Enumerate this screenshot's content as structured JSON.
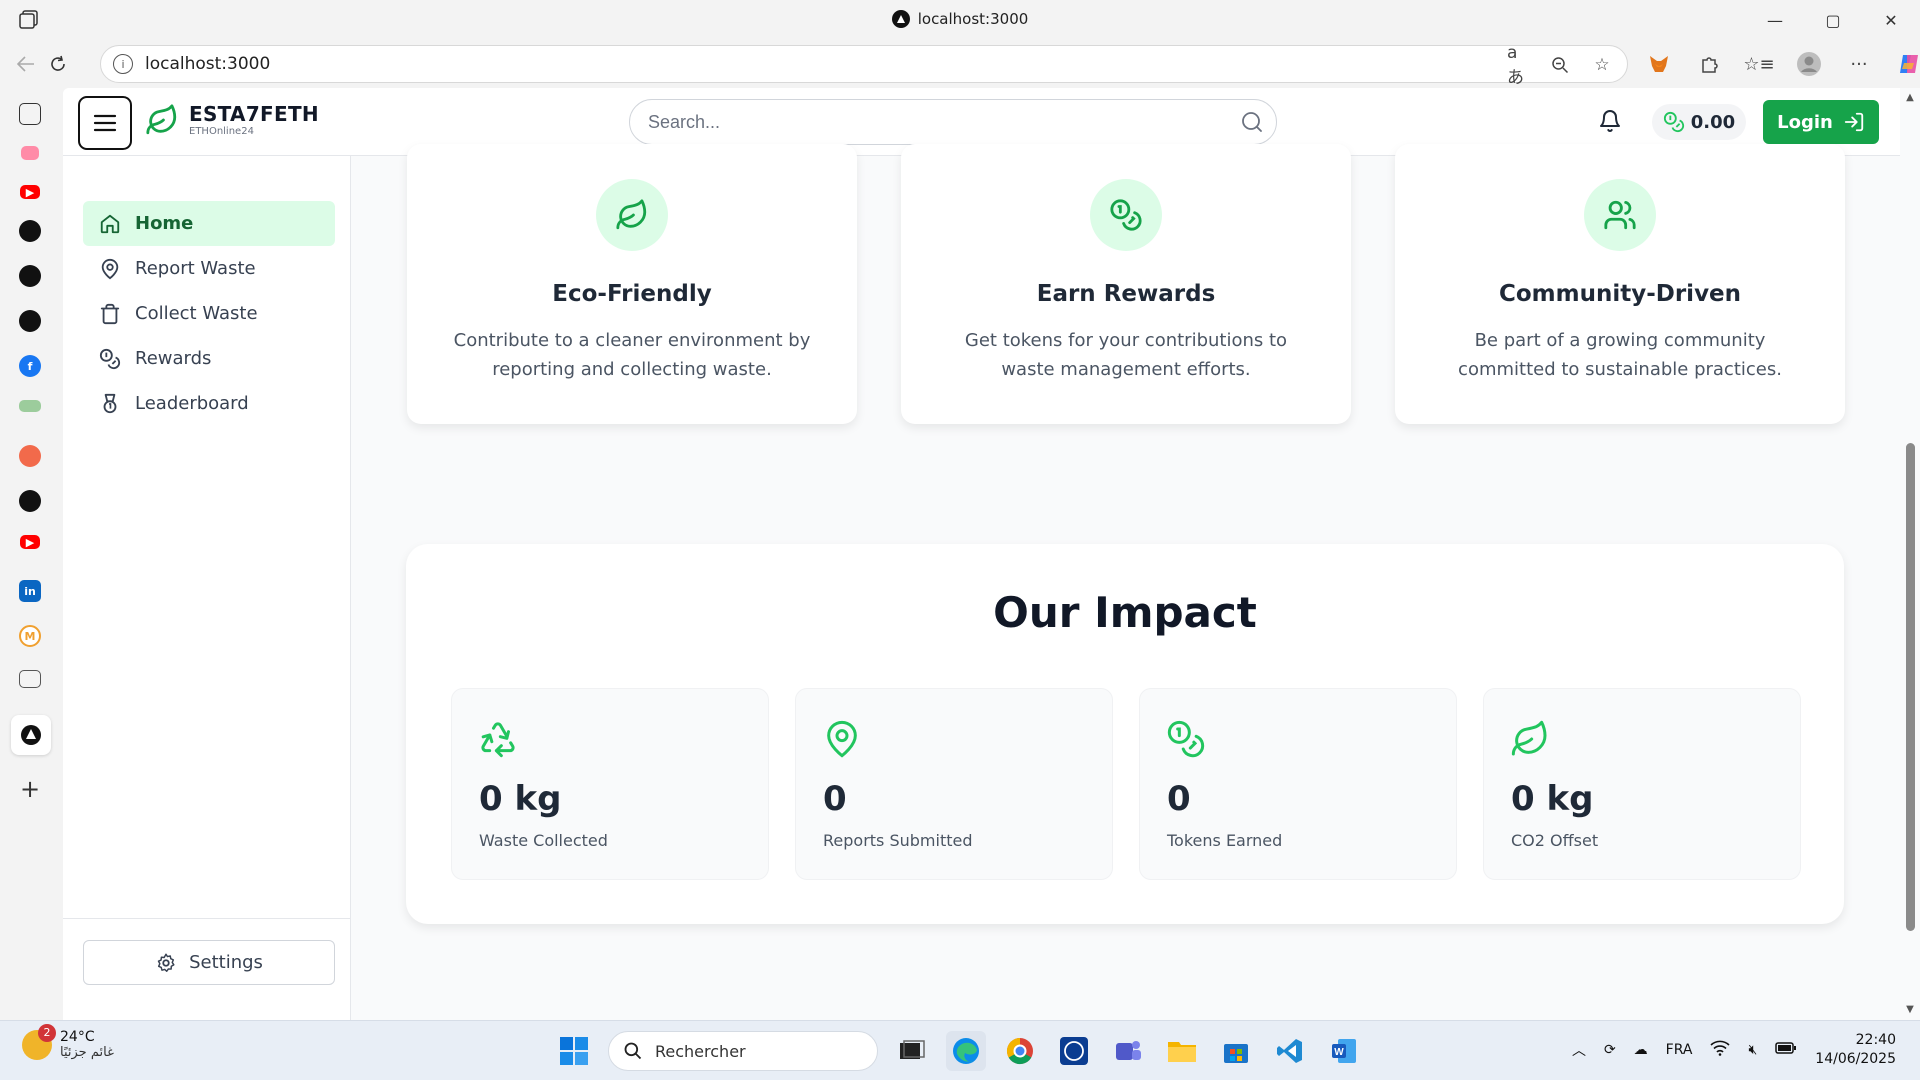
{
  "browser": {
    "tab_title": "localhost:3000",
    "url": "localhost:3000",
    "minimize": "—",
    "maximize": "▢",
    "close": "✕"
  },
  "header": {
    "brand": "ESTA7FETH",
    "tagline": "ETHOnline24",
    "search_placeholder": "Search...",
    "balance": "0.00",
    "login_label": "Login"
  },
  "sidebar": {
    "items": [
      {
        "label": "Home",
        "icon": "home-icon",
        "active": true
      },
      {
        "label": "Report Waste",
        "icon": "map-pin-icon",
        "active": false
      },
      {
        "label": "Collect Waste",
        "icon": "trash-icon",
        "active": false
      },
      {
        "label": "Rewards",
        "icon": "coins-icon",
        "active": false
      },
      {
        "label": "Leaderboard",
        "icon": "medal-icon",
        "active": false
      }
    ],
    "settings_label": "Settings"
  },
  "features": [
    {
      "title": "Eco-Friendly",
      "description": "Contribute to a cleaner environment by reporting and collecting waste.",
      "icon": "leaf-icon"
    },
    {
      "title": "Earn Rewards",
      "description": "Get tokens for your contributions to waste management efforts.",
      "icon": "coins-icon"
    },
    {
      "title": "Community-Driven",
      "description": "Be part of a growing community committed to sustainable practices.",
      "icon": "users-icon"
    }
  ],
  "impact": {
    "title": "Our Impact",
    "stats": [
      {
        "value": "0 kg",
        "label": "Waste Collected",
        "icon": "recycle-icon"
      },
      {
        "value": "0",
        "label": "Reports Submitted",
        "icon": "map-pin-icon"
      },
      {
        "value": "0",
        "label": "Tokens Earned",
        "icon": "coins-icon"
      },
      {
        "value": "0 kg",
        "label": "CO2 Offset",
        "icon": "leaf-icon"
      }
    ]
  },
  "taskbar": {
    "temperature": "24°C",
    "weather_text": "غائم جزئيًا",
    "weather_badge": "2",
    "search_placeholder": "Rechercher",
    "language": "FRA",
    "time": "22:40",
    "date": "14/06/2025"
  },
  "colors": {
    "brand_green": "#16a34a",
    "active_bg": "#dcfce7",
    "icon_green": "#22c55e"
  }
}
